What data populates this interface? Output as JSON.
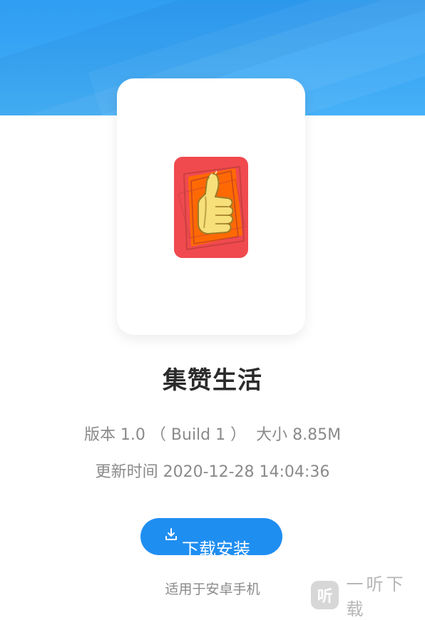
{
  "app": {
    "name": "集赞生活",
    "version_line": "版本 1.0 （ Build 1 ）  大小 8.85M",
    "updated_line": "更新时间 2020-12-28 14:04:36"
  },
  "download": {
    "label": "下载安装",
    "icon": "download-icon"
  },
  "platform_note": "适用于安卓手机",
  "watermark": {
    "logo_char": "听",
    "text": "一听下载"
  },
  "colors": {
    "hero_blue": "#3aa7f5",
    "button_blue": "#1f8ef1",
    "icon_red": "#f04a4f",
    "icon_orange": "#ff6a00",
    "thumb_yellow": "#f7df7a"
  }
}
